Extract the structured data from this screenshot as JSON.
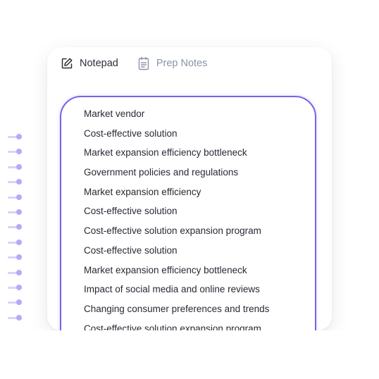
{
  "tabs": {
    "notepad": {
      "label": "Notepad",
      "icon": "edit-note-icon"
    },
    "prep_notes": {
      "label": "Prep Notes",
      "icon": "clipboard-icon"
    }
  },
  "colors": {
    "accent": "#7b61e8",
    "ring": "#b9a8f6",
    "active_tab": "#2b2f3a",
    "inactive_tab": "#8a93a3"
  },
  "notes": [
    "Market vendor",
    "Cost-effective solution",
    "Market expansion efficiency bottleneck",
    "Government policies and regulations",
    "Market expansion efficiency",
    "Cost-effective solution",
    "Cost-effective solution expansion program",
    "Cost-effective solution",
    "Market expansion efficiency bottleneck",
    "Impact of social media and online reviews",
    "Changing consumer preferences and trends",
    "Cost-effective solution expansion program"
  ]
}
